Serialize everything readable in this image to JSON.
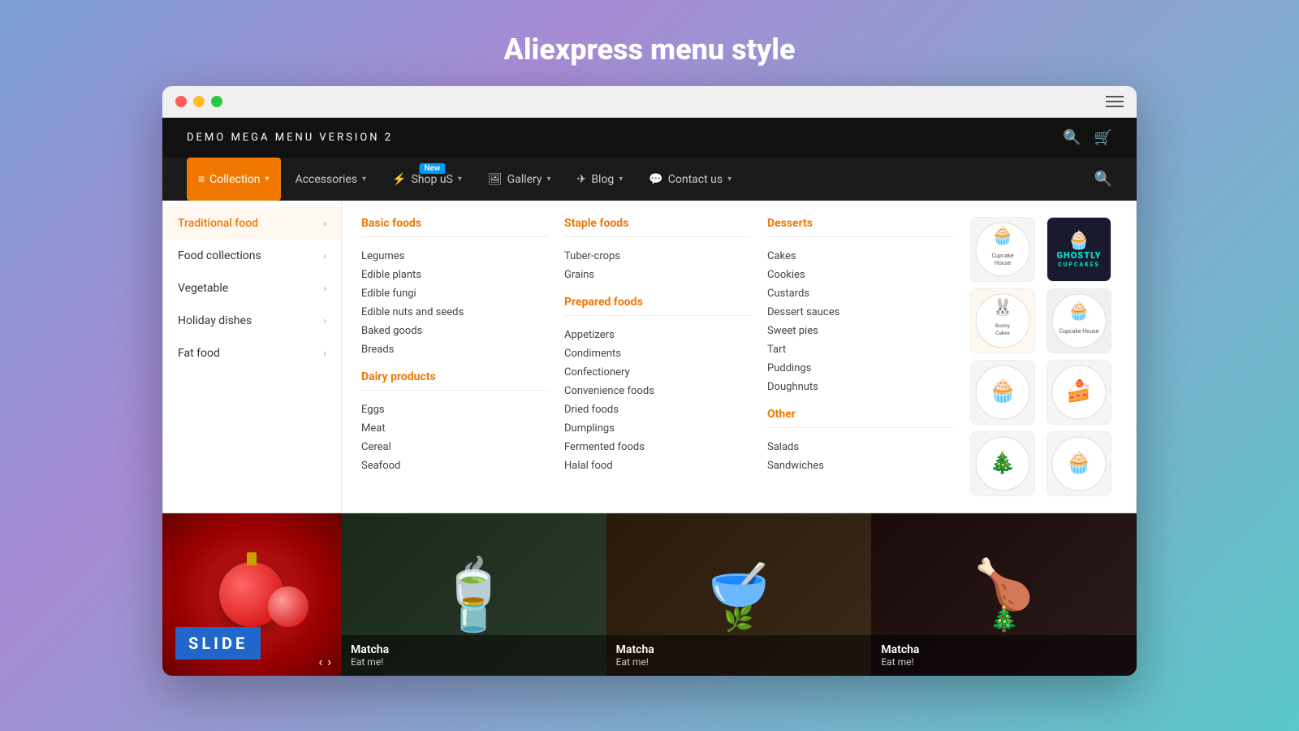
{
  "page": {
    "title": "Aliexpress menu style"
  },
  "browser": {
    "hamburger_label": "menu"
  },
  "topbar": {
    "site_title": "DEMO MEGA MENU VERSION 2",
    "search_icon": "search",
    "cart_icon": "cart"
  },
  "navbar": {
    "items": [
      {
        "id": "collection",
        "label": "Collection",
        "active": true,
        "has_icon": true
      },
      {
        "id": "accessories",
        "label": "Accessories",
        "active": false
      },
      {
        "id": "shop-us",
        "label": "Shop uS",
        "active": false,
        "badge": "New"
      },
      {
        "id": "gallery",
        "label": "Gallery",
        "active": false,
        "has_icon": true
      },
      {
        "id": "blog",
        "label": "Blog",
        "active": false
      },
      {
        "id": "contact",
        "label": "Contact us",
        "active": false
      }
    ]
  },
  "dropdown": {
    "sidebar_items": [
      {
        "id": "traditional",
        "label": "Traditional food",
        "active": true
      },
      {
        "id": "food-collections",
        "label": "Food collections",
        "active": false
      },
      {
        "id": "vegetable",
        "label": "Vegetable",
        "active": false
      },
      {
        "id": "holiday",
        "label": "Holiday dishes",
        "active": false
      },
      {
        "id": "fat-food",
        "label": "Fat food",
        "active": false
      }
    ],
    "columns": [
      {
        "id": "basic",
        "header": "Basic foods",
        "items": [
          "Legumes",
          "Edible plants",
          "Edible fungi",
          "Edible nuts and seeds",
          "Baked goods",
          "Breads"
        ]
      },
      {
        "id": "dairy",
        "header": "Dairy products",
        "items": [
          "Eggs",
          "Meat",
          "Cereal",
          "Seafood"
        ]
      },
      {
        "id": "staple",
        "header": "Staple foods",
        "items": [
          "Tuber-crops",
          "Grains"
        ]
      },
      {
        "id": "prepared",
        "header": "Prepared foods",
        "items": [
          "Appetizers",
          "Condiments",
          "Confectionery",
          "Convenience foods",
          "Dried foods",
          "Dumplings",
          "Fermented foods",
          "Halal food"
        ]
      },
      {
        "id": "desserts",
        "header": "Desserts",
        "items": [
          "Cakes",
          "Cookies",
          "Custards",
          "Dessert sauces",
          "Sweet pies",
          "Tart",
          "Puddings",
          "Doughnuts"
        ]
      },
      {
        "id": "other",
        "header": "Other",
        "items": [
          "Salads",
          "Sandwiches"
        ]
      }
    ],
    "brands": [
      {
        "id": "cupcake-house-1",
        "type": "cupcake-house"
      },
      {
        "id": "ghostly",
        "type": "ghostly"
      },
      {
        "id": "bunny-cakes",
        "type": "bunny-cakes"
      },
      {
        "id": "cupcake-house-2",
        "type": "cupcake-house-2"
      },
      {
        "id": "cupcake-3",
        "type": "cupcake-3"
      },
      {
        "id": "cupcake-4",
        "type": "cupcake-4"
      },
      {
        "id": "cupcake-5",
        "type": "cupcake-5"
      },
      {
        "id": "cupcake-6",
        "type": "cupcake-6"
      }
    ]
  },
  "hero": {
    "slide_label": "SLIDE",
    "slides": [
      {
        "title": "Matcha",
        "subtitle": "Eat me!"
      },
      {
        "title": "Matcha",
        "subtitle": "Eat me!"
      },
      {
        "title": "Matcha",
        "subtitle": "Eat me!"
      }
    ]
  }
}
